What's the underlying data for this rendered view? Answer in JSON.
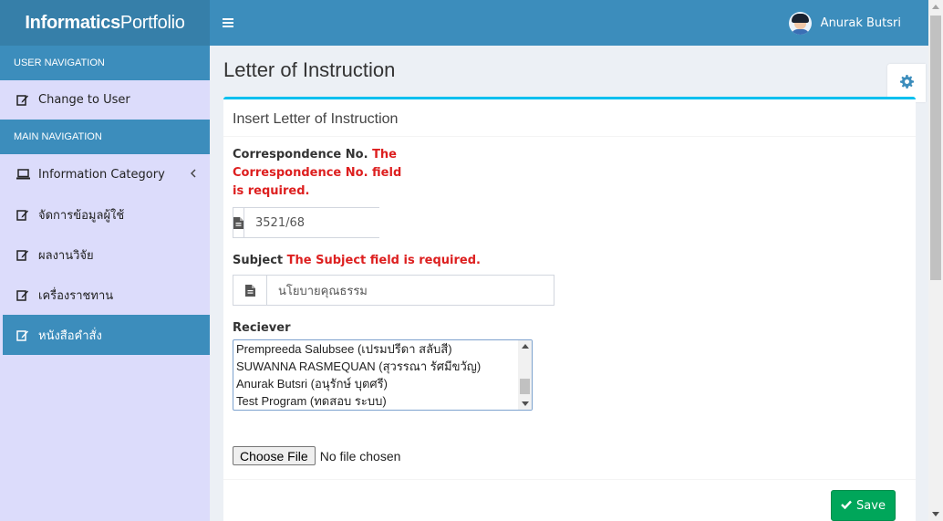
{
  "app": {
    "logo_bold": "Informatics",
    "logo_light": "Portfolio"
  },
  "header": {
    "user_name": "Anurak Butsri"
  },
  "sidebar": {
    "user_nav_header": "USER NAVIGATION",
    "change_user": "Change to User",
    "main_nav_header": "MAIN NAVIGATION",
    "items": [
      {
        "label": "Information Category",
        "icon": "laptop-icon"
      },
      {
        "label": "จัดการข้อมูลผู้ใช้",
        "icon": "edit-icon"
      },
      {
        "label": "ผลงานวิจัย",
        "icon": "edit-icon"
      },
      {
        "label": "เครื่องราชทาน",
        "icon": "edit-icon"
      },
      {
        "label": "หนังสือคำสั่ง",
        "icon": "edit-icon",
        "active": true
      }
    ]
  },
  "page": {
    "title": "Letter of Instruction"
  },
  "form": {
    "title": "Insert Letter of Instruction",
    "correspondence": {
      "label": "Correspondence No.",
      "error_line1": "The",
      "error_line2": "Correspondence No. field",
      "error_line3": "is required.",
      "value": "3521/68"
    },
    "subject": {
      "label": "Subject",
      "error": "The Subject field is required.",
      "value": "นโยบายคุณธรรม"
    },
    "receiver": {
      "label": "Reciever",
      "options": [
        "Prempreeda Salubsee (เปรมปรีดา สลับสี)",
        "SUWANNA RASMEQUAN (สุวรรณา รัศมีขวัญ)",
        "Anurak Butsri (อนุรักษ์ บุตศรี)",
        "Test Program (ทดสอบ ระบบ)"
      ]
    },
    "file": {
      "button": "Choose File",
      "status": "No file chosen"
    },
    "save_label": "Save"
  },
  "colors": {
    "primary": "#3c8dbc",
    "logo_bg": "#367fa9",
    "sidebar_bg": "#dcdcfb",
    "error": "#dd1f1f",
    "success": "#00a65a",
    "box_top": "#00c0ef"
  }
}
